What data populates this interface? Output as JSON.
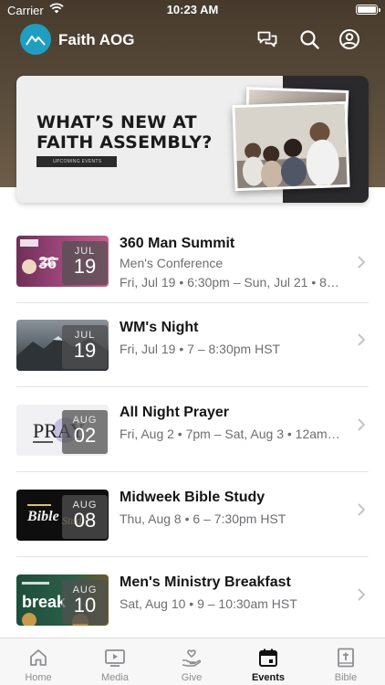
{
  "status_bar": {
    "carrier": "Carrier",
    "time": "10:23 AM"
  },
  "app": {
    "title": "Faith AOG",
    "accent": "#1f9ec2"
  },
  "header_icons": [
    "chat-icon",
    "search-icon",
    "account-icon"
  ],
  "banner": {
    "headline_line1": "WHAT’S NEW AT",
    "headline_line2": "FAITH ASSEMBLY?",
    "tag": "UPCOMING EVENTS"
  },
  "events": [
    {
      "title": "360 Man Summit",
      "subtitle": "Men's Conference",
      "detail": "Fri, Jul 19 • 6:30pm – Sun, Jul 21 • 8…",
      "month": "JUL",
      "day": "19",
      "thumb_color": "#8e3a6e"
    },
    {
      "title": "WM's Night",
      "subtitle": "Fri, Jul 19 • 7 – 8:30pm HST",
      "month": "JUL",
      "day": "19",
      "thumb_color": "#4a5258"
    },
    {
      "title": "All Night Prayer",
      "subtitle": "Fri, Aug 2 • 7pm – Sat, Aug 3 • 12am…",
      "month": "AUG",
      "day": "02",
      "thumb_color": "#f2f2f2"
    },
    {
      "title": "Midweek Bible Study",
      "subtitle": "Thu, Aug 8 • 6 – 7:30pm HST",
      "month": "AUG",
      "day": "08",
      "thumb_color": "#0e0e0e"
    },
    {
      "title": "Men's Ministry Breakfast",
      "subtitle": "Sat, Aug 10 • 9 – 10:30am HST",
      "month": "AUG",
      "day": "10",
      "thumb_color": "#1e4d3c"
    }
  ],
  "tabs": [
    {
      "label": "Home",
      "icon": "home-icon",
      "active": false
    },
    {
      "label": "Media",
      "icon": "media-icon",
      "active": false
    },
    {
      "label": "Give",
      "icon": "give-icon",
      "active": false
    },
    {
      "label": "Events",
      "icon": "calendar-icon",
      "active": true
    },
    {
      "label": "Bible",
      "icon": "bible-icon",
      "active": false
    }
  ]
}
